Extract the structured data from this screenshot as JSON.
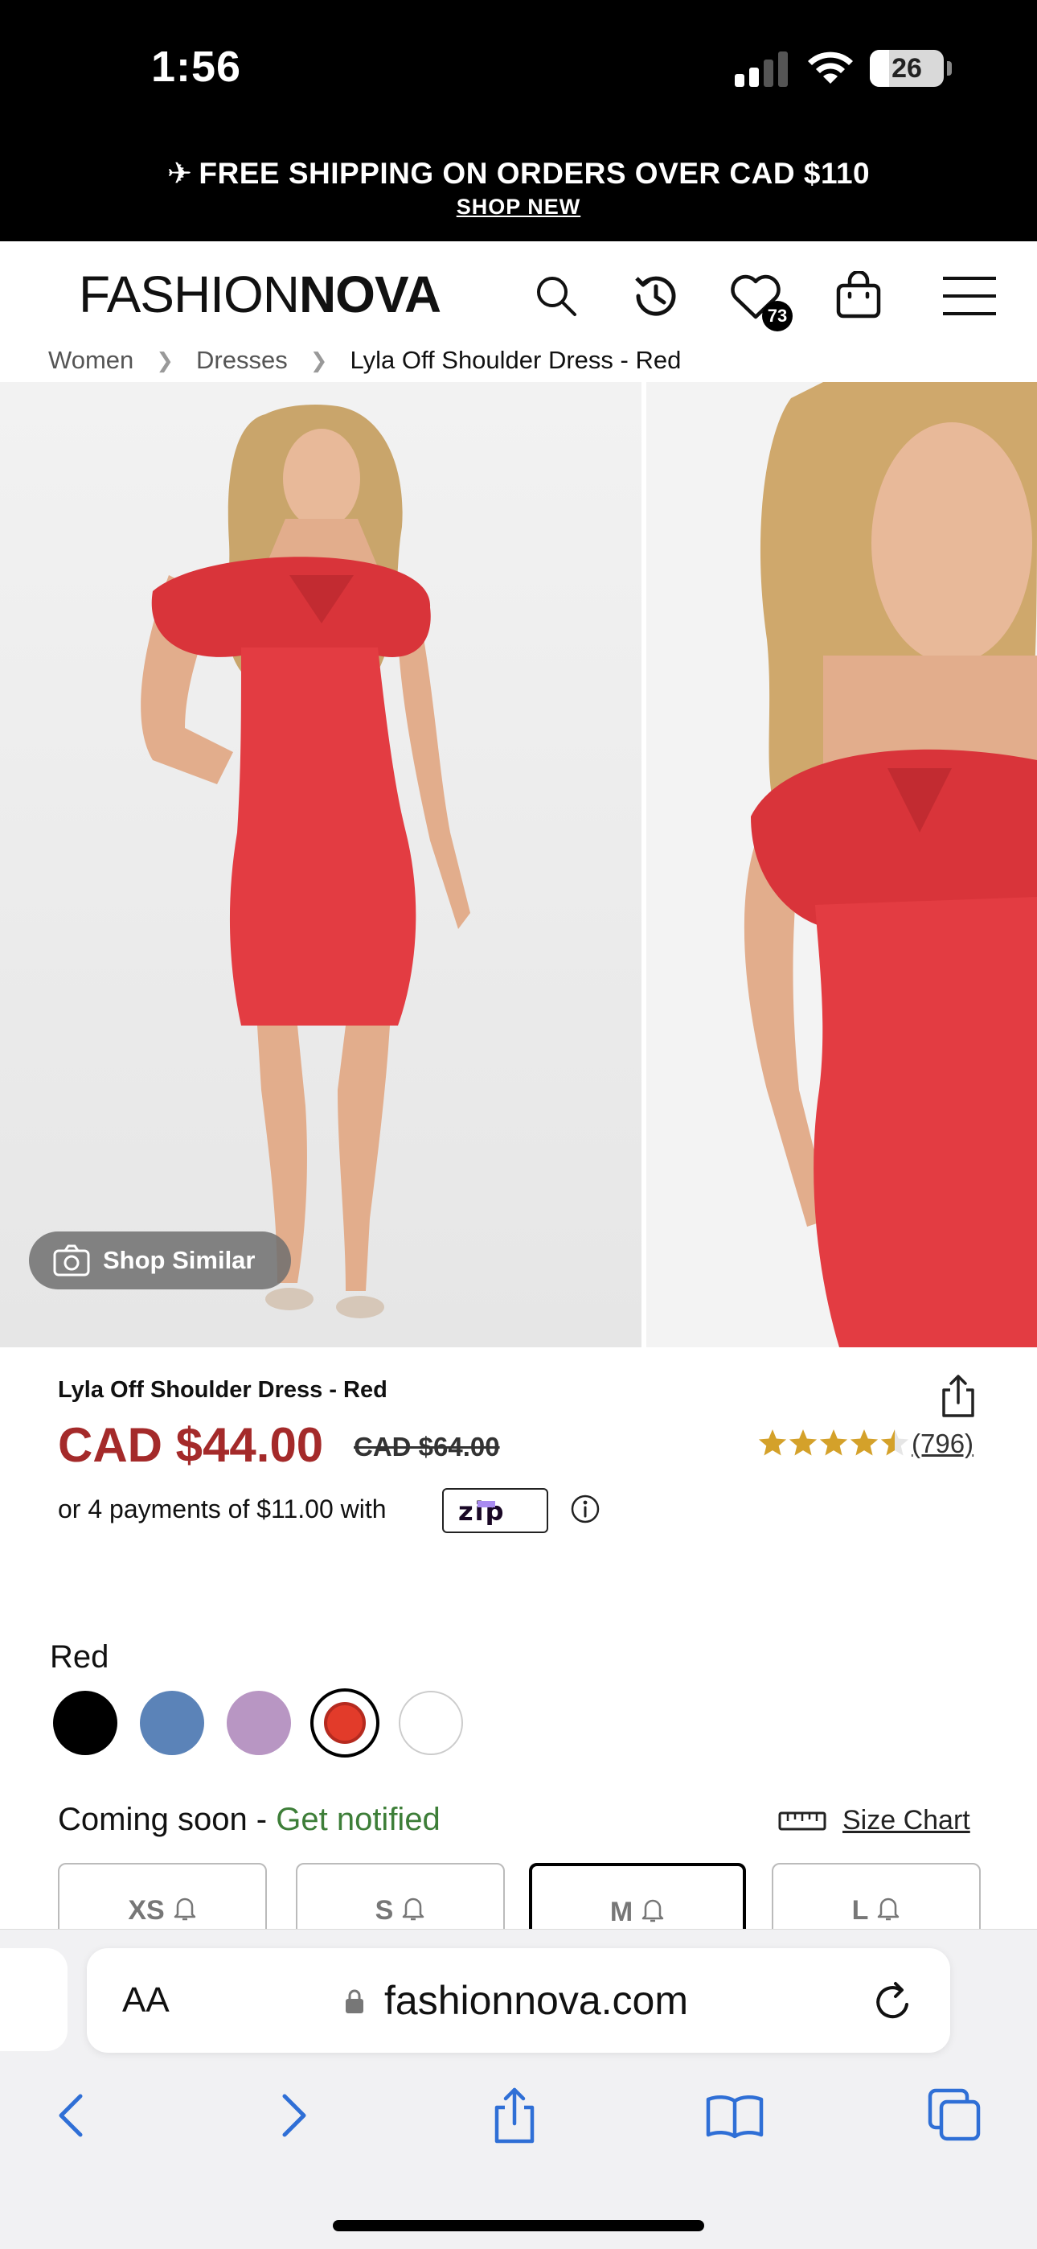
{
  "status_bar": {
    "time": "1:56",
    "battery": "26"
  },
  "promo": {
    "text": "FREE SHIPPING ON ORDERS OVER CAD $110",
    "link": "SHOP NEW"
  },
  "header": {
    "logo_light": "FASHION",
    "logo_bold": "NOVA",
    "wishlist_count": "73",
    "icons": [
      "search-icon",
      "history-icon",
      "heart-icon",
      "bag-icon",
      "menu-icon"
    ]
  },
  "breadcrumb": {
    "items": [
      "Women",
      "Dresses",
      "Lyla Off Shoulder Dress - Red"
    ]
  },
  "gallery": {
    "shop_similar": "Shop Similar"
  },
  "product": {
    "title": "Lyla Off Shoulder Dress - Red",
    "price": "CAD $44.00",
    "original_price": "CAD $64.00",
    "rating": 4.5,
    "review_count": "(796)",
    "installments": "or 4 payments of $11.00 with",
    "zip_logo": "zip"
  },
  "colors": {
    "selected_label": "Red",
    "swatches": [
      {
        "name": "black",
        "hex": "#000000"
      },
      {
        "name": "blue",
        "hex": "#5b83b8"
      },
      {
        "name": "lavender",
        "hex": "#b896c3"
      },
      {
        "name": "red",
        "hex": "#e23b2a"
      },
      {
        "name": "white",
        "hex": "#ffffff"
      }
    ]
  },
  "sizes": {
    "status": "Coming soon - ",
    "notify": "Get notified",
    "size_chart": "Size Chart",
    "options": [
      "XS",
      "S",
      "M",
      "L"
    ],
    "selected": "M"
  },
  "browser": {
    "text_size": "AA",
    "url": "fashionnova.com"
  }
}
